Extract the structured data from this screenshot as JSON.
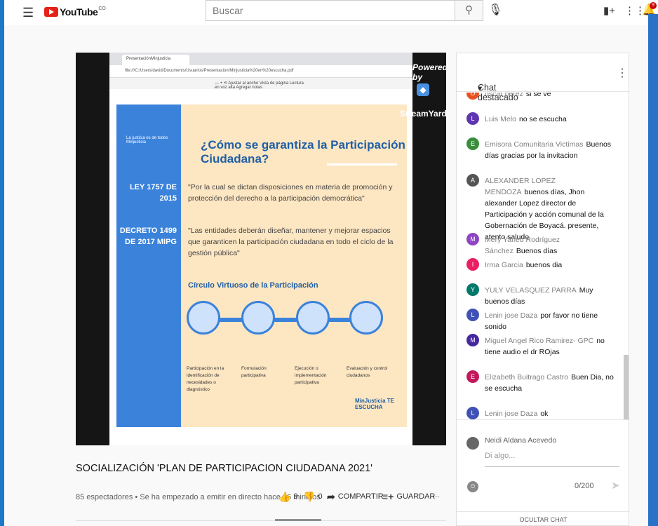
{
  "header": {
    "brand": "YouTube",
    "country": "CO",
    "search_placeholder": "Buscar",
    "notifications": "9"
  },
  "video": {
    "browser_tab": "PresentaciónMinjusticia",
    "address": "file:///C:/Users/david/Documents/Usuarios/Presentacion/Minjusticia%20en%20escucha.pdf",
    "pdf_toolbar": "—   +   ⟲   Ajustar al ancho   Vista de página   Lectura en voz alta   Agregar notas",
    "overlay_powered": "Powered by",
    "overlay_brand": "StreamYard",
    "slide": {
      "logo": "La justicia es de todos   Minjusticia",
      "title": "¿Cómo se garantiza la Participación Ciudadana?",
      "law1_label": "LEY 1757 DE 2015",
      "law1_text": "\"Por la cual se dictan disposiciones en materia de promoción y protección del derecho a la participación democrática\"",
      "law2_label": "DECRETO 1499 DE 2017 MIPG",
      "law2_text": "\"Las entidades deberán diseñar, mantener y mejorar espacios que garanticen la participación ciudadana en todo el ciclo de la gestión pública\"",
      "circle_title": "Círculo Virtuoso de la Participación",
      "circles": [
        "Participación en la identificación de necesidades o diagnóstico",
        "Formulación participativa",
        "Ejecución o implementación participativa",
        "Evaluación y control ciudadanos"
      ],
      "footer_logo": "MinJusticia TE ESCUCHA"
    }
  },
  "info": {
    "title": "SOCIALIZACIÓN 'PLAN DE PARTICIPACION CIUDADANA 2021'",
    "meta": "85 espectadores • Se ha empezado a emitir en directo hace 16 minutos",
    "likes": "9",
    "dislikes": "0",
    "share": "COMPARTIR",
    "save": "GUARDAR",
    "more": "..."
  },
  "chat": {
    "header": "Chat destacado",
    "messages": [
      {
        "author": "oscar perez",
        "text": "si se ve",
        "initial": "O",
        "color": "#e8501f"
      },
      {
        "author": "Luis Melo",
        "text": "no se escucha",
        "initial": "L",
        "color": "#5e35b1"
      },
      {
        "author": "Emisora Comunitaria Victimas",
        "text": "Buenos días gracias por la invitacion",
        "initial": "E",
        "color": "#3a8d3a"
      },
      {
        "author": "ALEXANDER LOPEZ MENDOZA",
        "text": "buenos días, Jhon alexander Lopez director de Participación y acción comunal de la Gobernación de Boyacá. presente, atento saludo",
        "initial": "A",
        "color": "#555555"
      },
      {
        "author": "Mery Yaned Rodríguez Sánchez",
        "text": "Buenos días",
        "initial": "M",
        "color": "#8e44c4"
      },
      {
        "author": "Irma Garcia",
        "text": "buenos dia",
        "initial": "I",
        "color": "#e91e63"
      },
      {
        "author": "YULY VELASQUEZ PARRA",
        "text": "Muy buenos días",
        "initial": "Y",
        "color": "#00796b"
      },
      {
        "author": "Lenin jose Daza",
        "text": "por favor no tiene sonido",
        "initial": "L",
        "color": "#3f51b5"
      },
      {
        "author": "Miguel Angel Rico Ramirez- GPC",
        "text": "no tiene audio el dr ROjas",
        "initial": "M",
        "color": "#4527a0"
      },
      {
        "author": "Elizabeth Buitrago Castro",
        "text": "Buen Dia, no se escucha",
        "initial": "E",
        "color": "#c2185b"
      },
      {
        "author": "Lenin jose Daza",
        "text": "ok",
        "initial": "L",
        "color": "#3f51b5"
      }
    ],
    "current_user": "Neidi Aldana Acevedo",
    "input_placeholder": "Di algo...",
    "char_count": "0/200",
    "hide_label": "OCULTAR CHAT"
  }
}
